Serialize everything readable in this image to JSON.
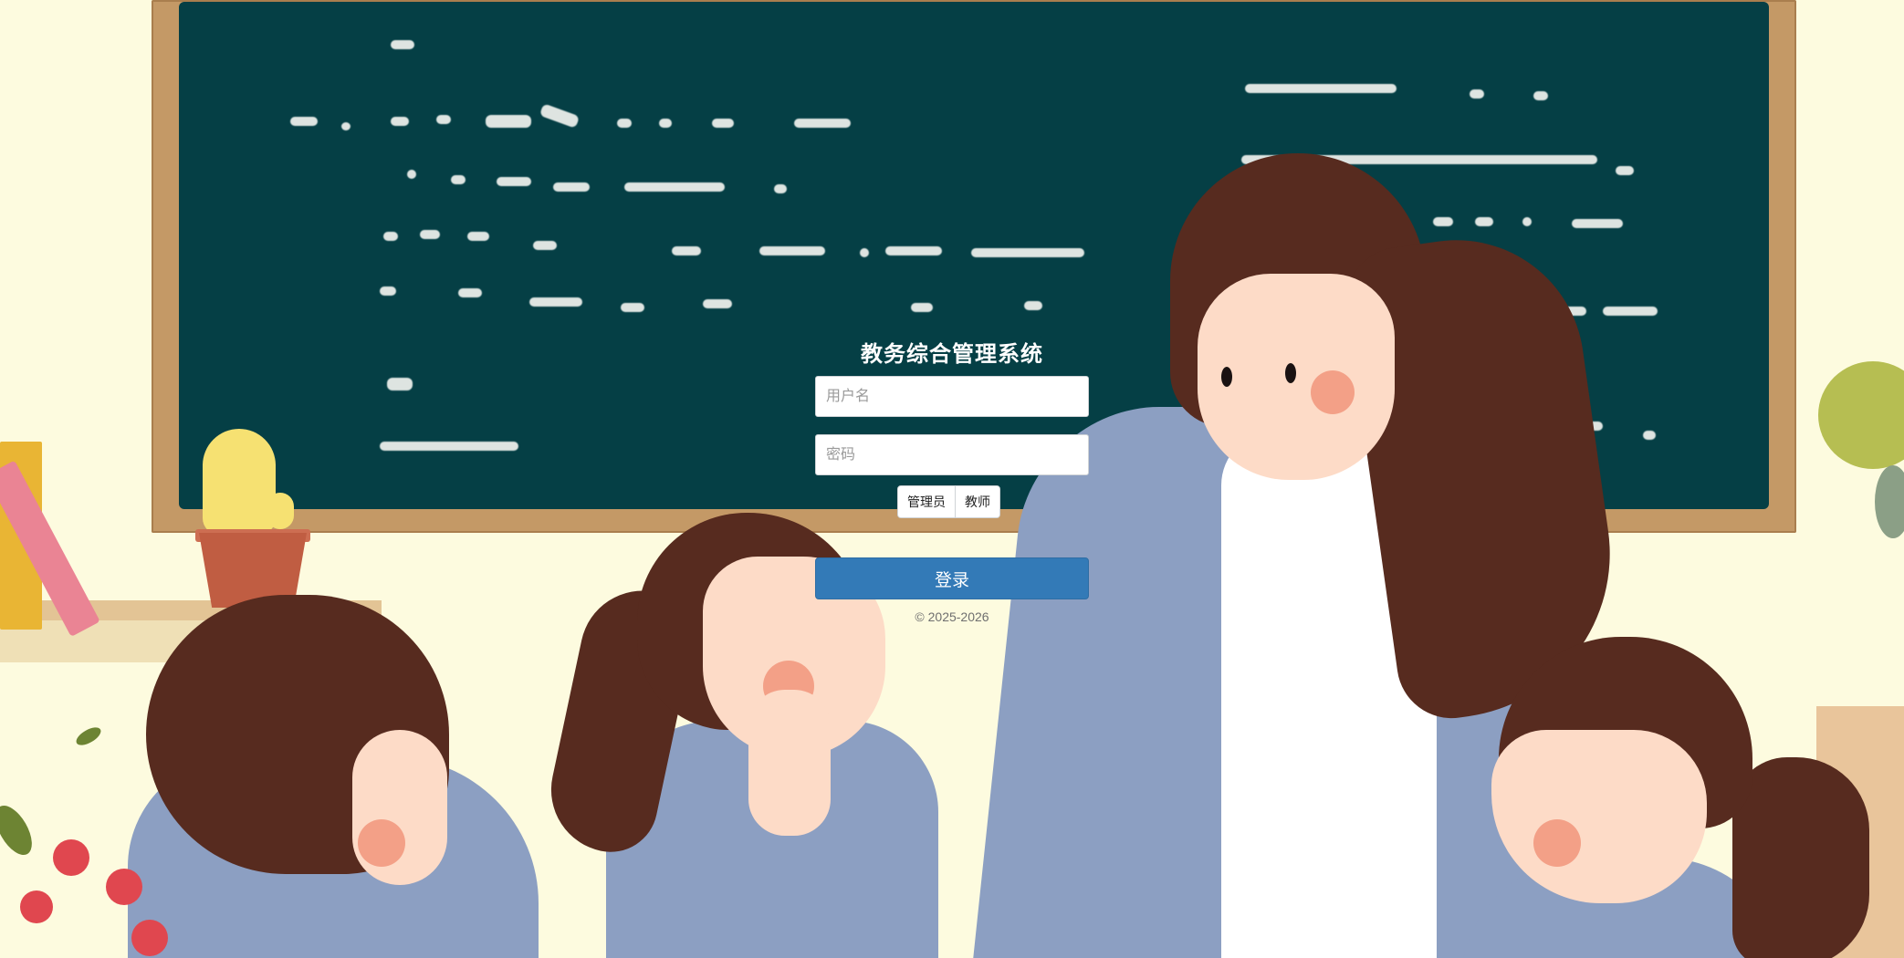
{
  "login": {
    "title": "教务综合管理系统",
    "username_placeholder": "用户名",
    "password_placeholder": "密码",
    "roles": [
      "管理员",
      "教师"
    ],
    "submit_label": "登录",
    "copyright": "© 2025-2026"
  },
  "background": {
    "description_icon": "classroom-illustration",
    "board_color": "#053f45",
    "accent_color": "#337ab7"
  }
}
